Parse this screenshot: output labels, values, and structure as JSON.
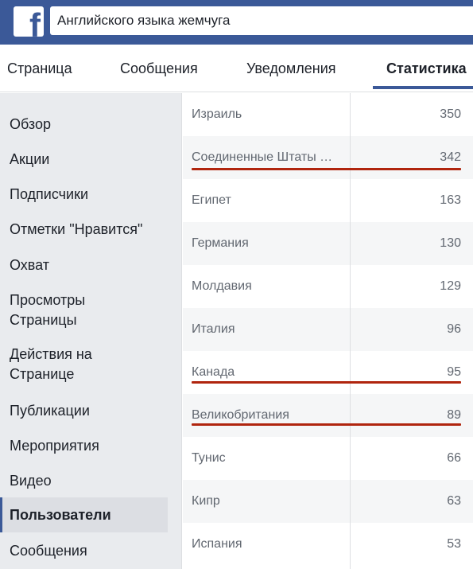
{
  "header": {
    "logo_letter": "f",
    "search_value": "Английского языка жемчуга"
  },
  "tabs": [
    {
      "label": "Страница"
    },
    {
      "label": "Сообщения"
    },
    {
      "label": "Уведомления"
    },
    {
      "label": "Статистика",
      "active": true
    }
  ],
  "sidebar": {
    "items": [
      {
        "label": "Обзор"
      },
      {
        "label": "Акции"
      },
      {
        "label": "Подписчики"
      },
      {
        "label": "Отметки \"Нравится\""
      },
      {
        "label": "Охват"
      },
      {
        "label": "Просмотры Страницы"
      },
      {
        "label": "Действия на Странице"
      },
      {
        "label": "Публикации"
      },
      {
        "label": "Мероприятия"
      },
      {
        "label": "Видео"
      },
      {
        "label": "Пользователи",
        "active": true
      },
      {
        "label": "Сообщения"
      }
    ]
  },
  "table": {
    "rows": [
      {
        "country": "Израиль",
        "count": "350"
      },
      {
        "country": "Соединенные Штаты …",
        "count": "342",
        "highlighted": true
      },
      {
        "country": "Египет",
        "count": "163"
      },
      {
        "country": "Германия",
        "count": "130"
      },
      {
        "country": "Молдавия",
        "count": "129"
      },
      {
        "country": "Италия",
        "count": "96"
      },
      {
        "country": "Канада",
        "count": "95",
        "highlighted": true
      },
      {
        "country": "Великобритания",
        "count": "89",
        "highlighted": true
      },
      {
        "country": "Тунис",
        "count": "66"
      },
      {
        "country": "Кипр",
        "count": "63"
      },
      {
        "country": "Испания",
        "count": "53"
      }
    ]
  },
  "colors": {
    "brand_blue": "#3b5998",
    "highlight_red": "#b0250e"
  }
}
